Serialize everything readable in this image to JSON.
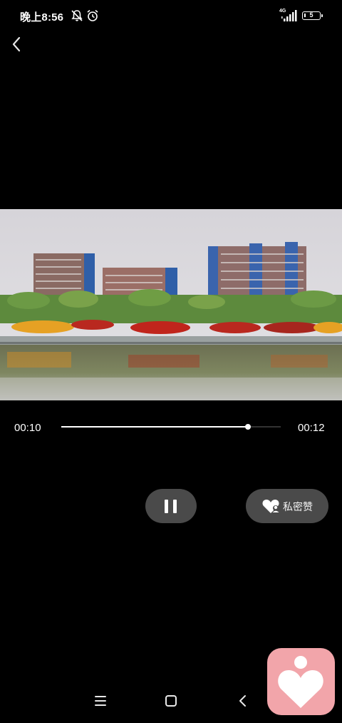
{
  "status_bar": {
    "time": "晚上8:56",
    "network": "4G",
    "battery": "5"
  },
  "player": {
    "current_time": "00:10",
    "total_time": "00:12",
    "progress": 0.85
  },
  "controls": {
    "private_like_label": "私密赞"
  },
  "colors": {
    "background": "#000000",
    "button_bg": "#4a4a4a",
    "float_app_bg": "#f2a5aa"
  },
  "icons": [
    "back-icon",
    "mute-bell-icon",
    "alarm-icon",
    "signal-icon",
    "battery-icon",
    "pause-icon",
    "heart-icon",
    "menu-icon",
    "home-icon",
    "back-nav-icon"
  ]
}
